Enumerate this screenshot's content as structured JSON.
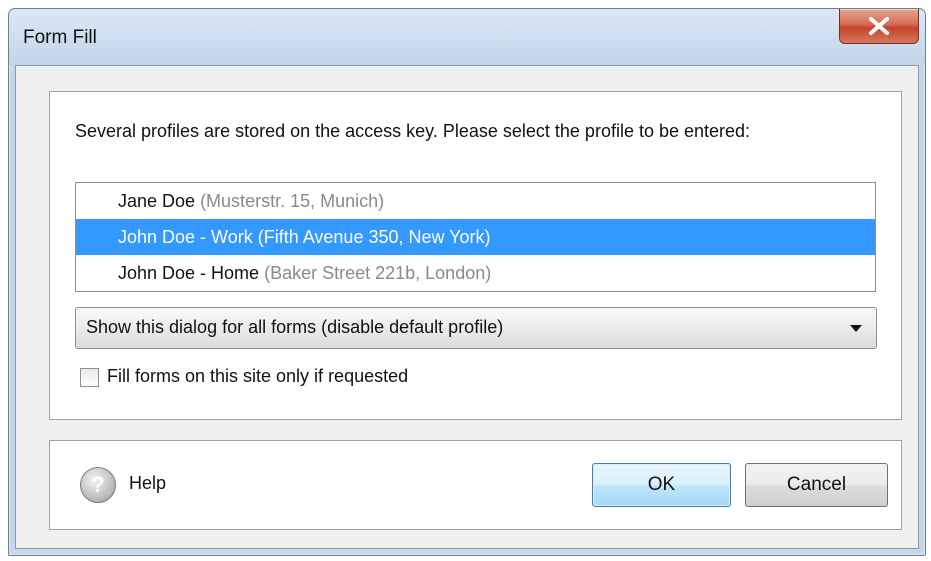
{
  "window": {
    "title": "Form Fill",
    "close_icon": "close-icon"
  },
  "instructions": "Several profiles are stored on the access key. Please select the profile to be entered:",
  "profiles": [
    {
      "name": "Jane Doe",
      "address": "(Musterstr. 15, Munich)",
      "selected": false
    },
    {
      "name": "John Doe - Work",
      "address": "(Fifth Avenue 350, New York)",
      "selected": true
    },
    {
      "name": "John Doe - Home",
      "address": "(Baker Street 221b, London)",
      "selected": false
    }
  ],
  "dropdown": {
    "selected": "Show this dialog for all forms (disable default profile)"
  },
  "checkbox": {
    "label": "Fill forms on this site only if requested",
    "checked": false
  },
  "footer": {
    "help_label": "Help",
    "help_icon_glyph": "?",
    "ok_label": "OK",
    "cancel_label": "Cancel"
  },
  "colors": {
    "selection": "#3399ff",
    "address_text": "#8a8a8a"
  }
}
